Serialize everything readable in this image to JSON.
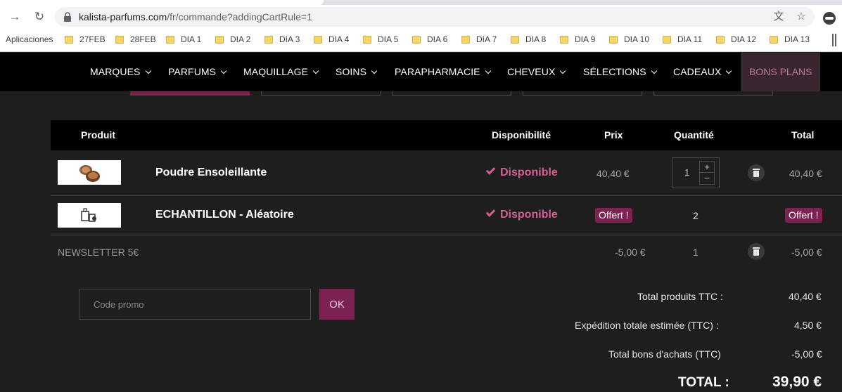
{
  "browser": {
    "url_host": "kalista-parfums.com",
    "url_path": "/fr/commande?addingCartRule=1",
    "bookmarks": [
      "Aplicaciones",
      "27FEB",
      "28FEB",
      "DIA 1",
      "DIA 2",
      "DIA 3",
      "DIA 4",
      "DIA 5",
      "DIA 6",
      "DIA 7",
      "DIA 8",
      "DIA 9",
      "DIA 10",
      "DIA 11",
      "DIA 12",
      "DIA 13"
    ]
  },
  "nav": {
    "items": [
      "MARQUES",
      "PARFUMS",
      "MAQUILLAGE",
      "SOINS",
      "PARAPHARMACIE",
      "CHEVEUX",
      "SÉLECTIONS",
      "CADEAUX"
    ],
    "active": "BONS PLANS"
  },
  "cart": {
    "headers": {
      "product": "Produit",
      "availability": "Disponibilité",
      "price": "Prix",
      "quantity": "Quantité",
      "total": "Total"
    },
    "rows": [
      {
        "name": "Poudre Ensoleillante",
        "availability": "Disponible",
        "price": "40,40 €",
        "quantity": "1",
        "total": "40,40 €"
      },
      {
        "name": "ECHANTILLON - Aléatoire",
        "availability": "Disponible",
        "price": "Offert !",
        "quantity": "2",
        "total": "Offert !"
      }
    ],
    "discount": {
      "name": "NEWSLETTER 5€",
      "price": "-5,00 €",
      "quantity": "1",
      "total": "-5,00 €"
    }
  },
  "promo": {
    "placeholder": "Code promo",
    "button": "OK"
  },
  "totals": {
    "products_label": "Total produits TTC :",
    "products_value": "40,40 €",
    "shipping_label": "Expédition totale estimée (TTC) :",
    "shipping_value": "4,50 €",
    "vouchers_label": "Total bons d'achats (TTC)",
    "vouchers_value": "-5,00 €",
    "grand_label": "TOTAL :",
    "grand_value": "39,90 €"
  }
}
